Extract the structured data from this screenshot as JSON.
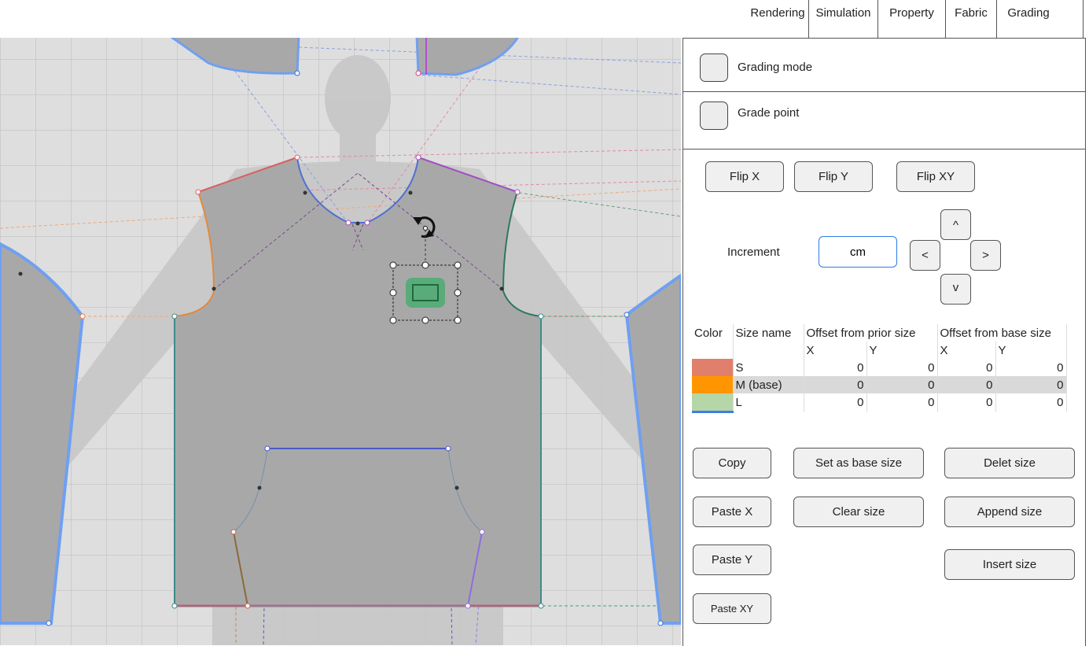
{
  "tabs": [
    "Rendering",
    "Simulation",
    "Property",
    "Fabric",
    "Grading"
  ],
  "panel": {
    "grading_mode_label": "Grading mode",
    "grade_point_label": "Grade point",
    "flip_x": "Flip X",
    "flip_y": "Flip Y",
    "flip_xy": "Flip XY",
    "increment_label": "Increment",
    "increment_value": "cm",
    "arrow_up": "^",
    "arrow_down": "v",
    "arrow_left": "<",
    "arrow_right": ">",
    "table": {
      "headers": [
        "Color",
        "Size name",
        "Offset from prior size",
        "Offset from base size"
      ],
      "subheaders": [
        "X",
        "Y",
        "X",
        "Y"
      ],
      "rows": [
        {
          "color": "#e07f6c",
          "name": "S",
          "px": "0",
          "py": "0",
          "bx": "0",
          "by": "0"
        },
        {
          "color": "#ff9500",
          "name": "M (base)",
          "px": "0",
          "py": "0",
          "bx": "0",
          "by": "0"
        },
        {
          "color": "#b5d7a8",
          "name": "L",
          "px": "0",
          "py": "0",
          "bx": "0",
          "by": "0"
        }
      ]
    },
    "copy": "Copy",
    "set_base": "Set as base size",
    "delete_size": "Delet size",
    "paste_x": "Paste X",
    "clear_size": "Clear size",
    "append_size": "Append size",
    "paste_y": "Paste Y",
    "insert_size": "Insert size",
    "paste_xy": "Paste XY"
  },
  "colors": {
    "accent": "#2f7de1",
    "pattern_fill": "#a9a8a9",
    "outline_blue": "#6fa0f0",
    "selection_green": "#3fae6a"
  }
}
